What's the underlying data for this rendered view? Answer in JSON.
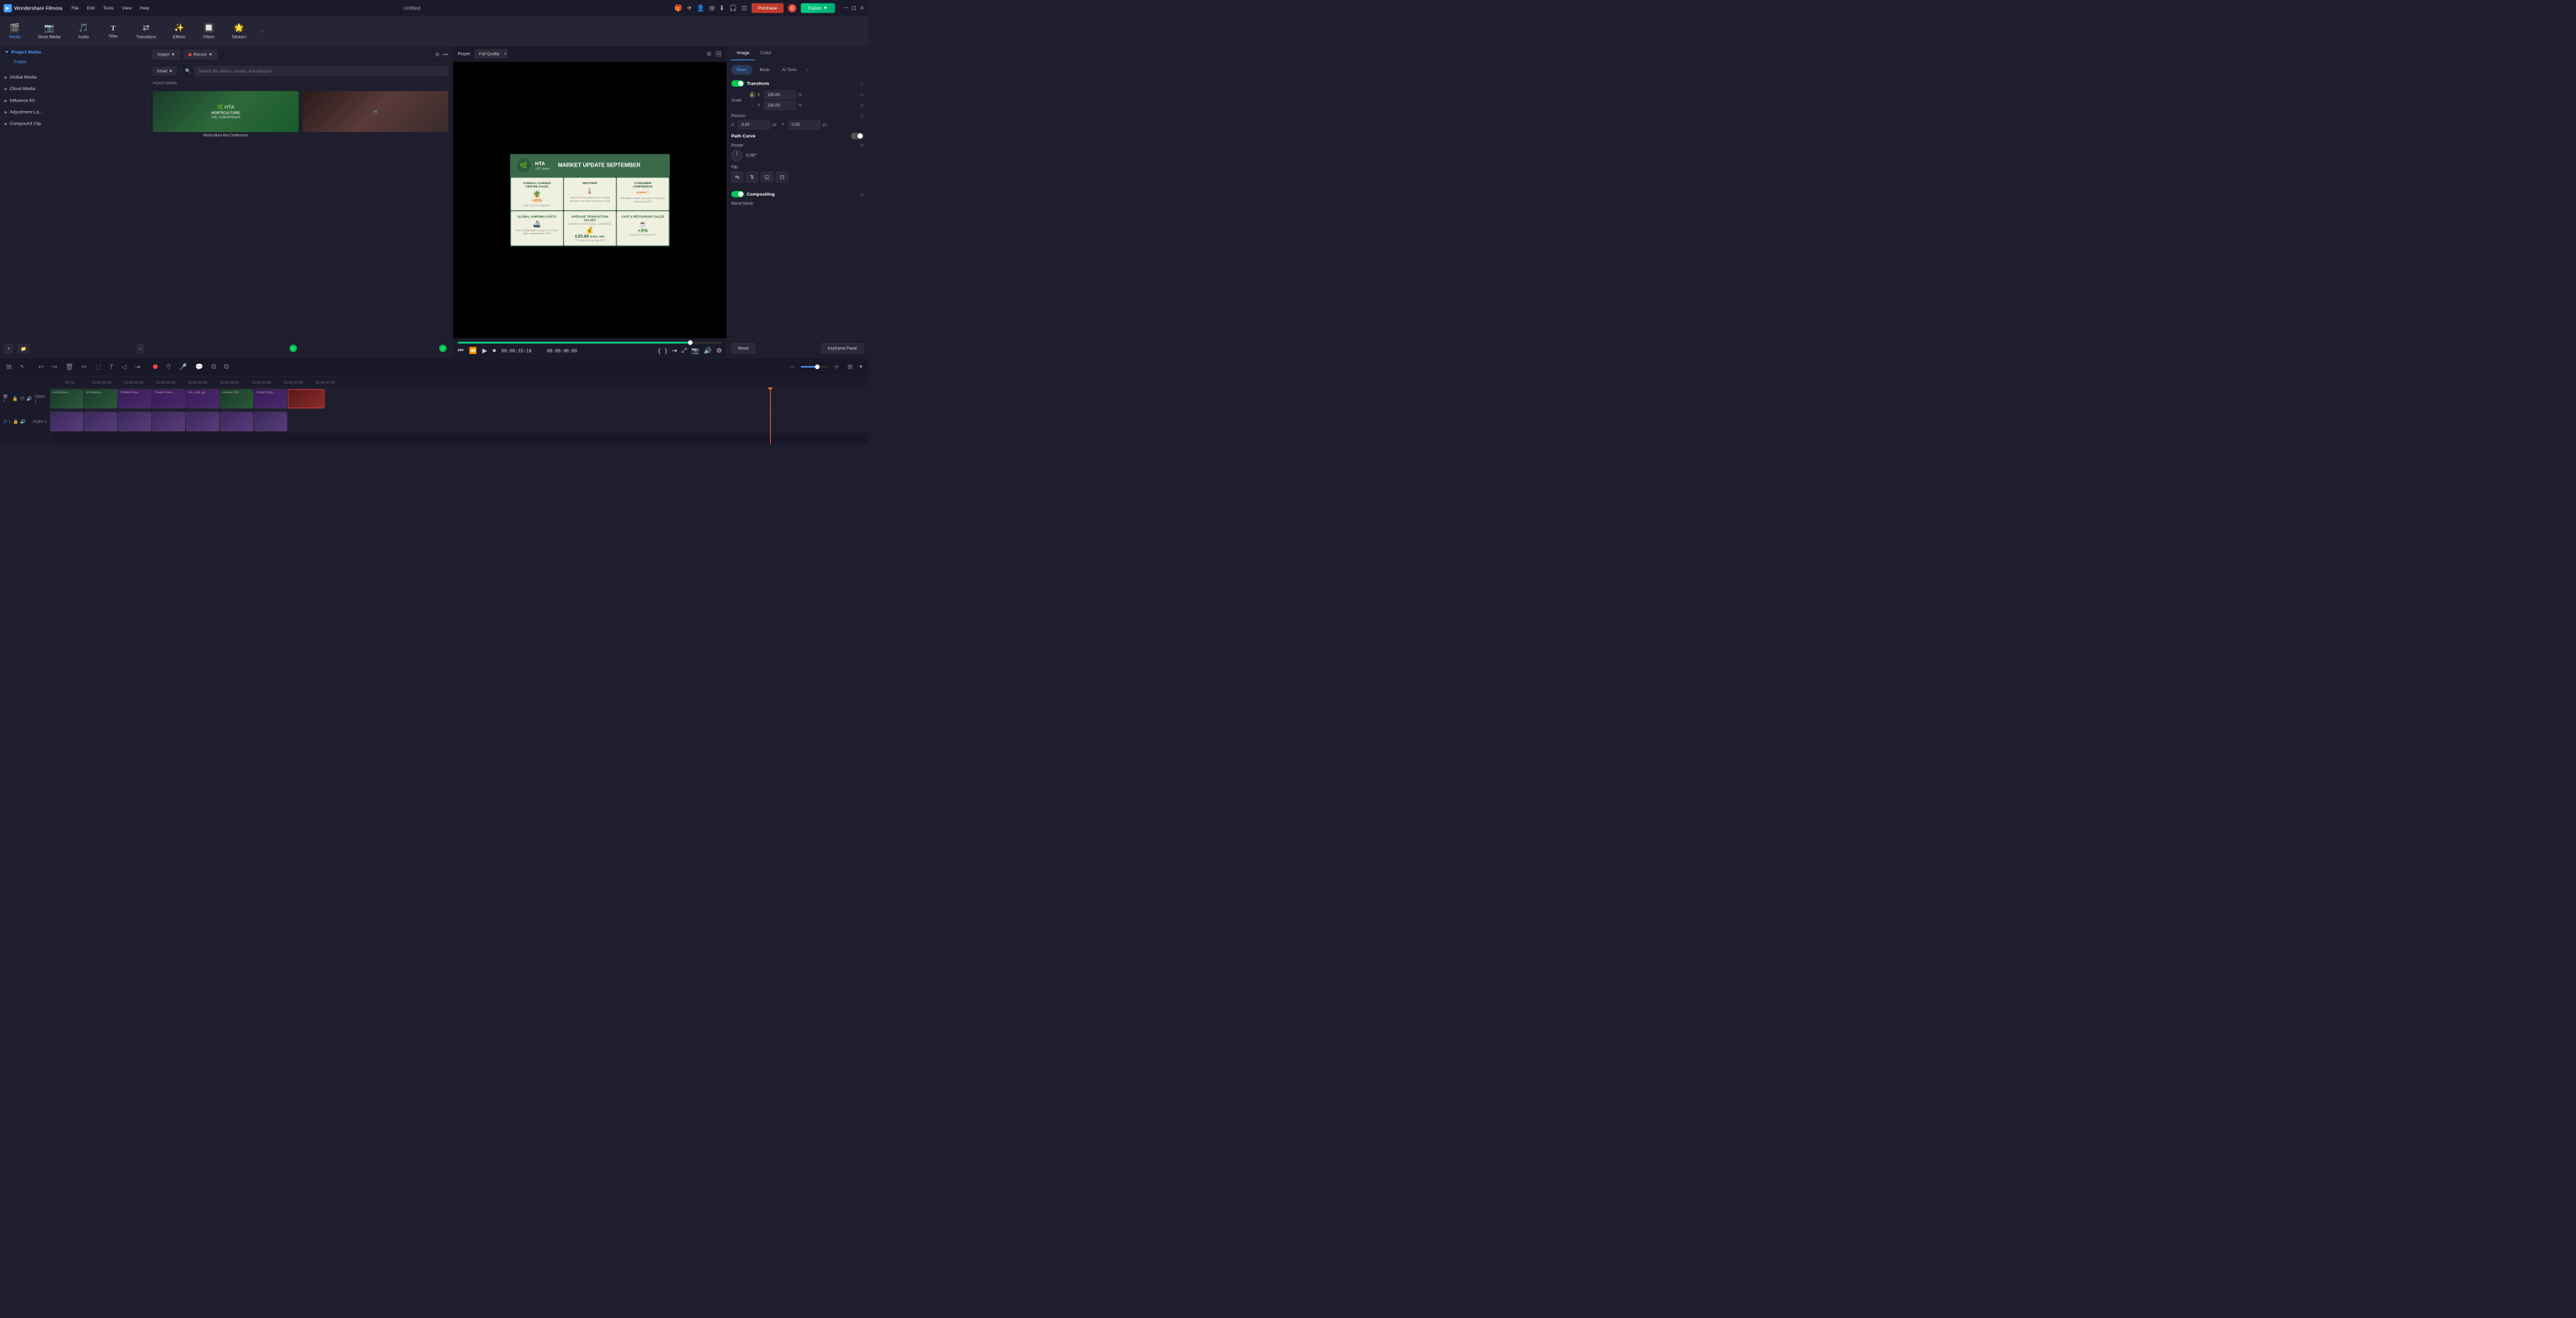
{
  "app": {
    "name": "Wondershare Filmora",
    "window_title": "Untitled"
  },
  "titlebar": {
    "menu": [
      "File",
      "Edit",
      "Tools",
      "View",
      "Help"
    ],
    "purchase_label": "Purchase",
    "export_label": "Export",
    "title": "Untitled"
  },
  "toolbar": {
    "items": [
      {
        "id": "media",
        "label": "Media",
        "icon": "🎬",
        "active": true
      },
      {
        "id": "stock_media",
        "label": "Stock Media",
        "icon": "📦"
      },
      {
        "id": "audio",
        "label": "Audio",
        "icon": "🎵"
      },
      {
        "id": "titles",
        "label": "Titles",
        "icon": "T"
      },
      {
        "id": "transitions",
        "label": "Transitions",
        "icon": "⇄"
      },
      {
        "id": "effects",
        "label": "Effects",
        "icon": "✨"
      },
      {
        "id": "filters",
        "label": "Filters",
        "icon": "🔲"
      },
      {
        "id": "stickers",
        "label": "Stickers",
        "icon": "🌟"
      }
    ]
  },
  "left_panel": {
    "project_media_label": "Project Media",
    "folder_label": "Folder",
    "sections": [
      {
        "label": "Global Media"
      },
      {
        "label": "Cloud Media"
      },
      {
        "label": "Influence Kit"
      },
      {
        "label": "Adjustment La..."
      },
      {
        "label": "Compound Clip"
      }
    ]
  },
  "media_panel": {
    "import_label": "Import",
    "record_label": "Record",
    "smart_label": "Smart",
    "search_placeholder": "Search file names, visuals, and dialogue",
    "import_media_heading": "Import Media",
    "items": [
      {
        "label": "Horticulture-the-Conference",
        "has_check": true
      },
      {
        "label": "",
        "has_check": true
      }
    ]
  },
  "player": {
    "label": "Player",
    "quality": "Full Quality",
    "current_time": "00:00:35:18",
    "total_time": "00:00:40:00",
    "progress_pct": 88
  },
  "right_panel": {
    "tabs": [
      "Image",
      "Color"
    ],
    "active_tab": "Image",
    "sub_tabs": [
      "Basic",
      "Mask",
      "AI Tools"
    ],
    "active_sub_tab": "Basic",
    "transform": {
      "label": "Transform",
      "enabled": true,
      "scale": {
        "label": "Scale",
        "x_label": "X",
        "y_label": "Y",
        "x_value": "100.00",
        "y_value": "100.00",
        "unit": "%"
      },
      "position": {
        "label": "Position",
        "x_label": "X",
        "y_label": "Y",
        "x_value": "0.00",
        "y_value": "0.00",
        "x_unit": "px",
        "y_unit": "px"
      },
      "path_curve": {
        "label": "Path Curve",
        "enabled": false
      },
      "rotate": {
        "label": "Rotate",
        "value": "0.00°"
      },
      "flip": {
        "label": "Flip",
        "buttons": [
          "⇆",
          "⇅",
          "◱",
          "◳"
        ]
      }
    },
    "compositing": {
      "label": "Compositing",
      "enabled": true
    },
    "blend_mode": {
      "label": "Blend Mode"
    },
    "reset_label": "Reset",
    "keyframe_panel_label": "Keyframe Panel"
  },
  "timeline": {
    "tracks": [
      {
        "label": "Video 1",
        "number": 1
      },
      {
        "label": "Audio 1",
        "number": 1
      }
    ],
    "clips": [
      {
        "label": "Horticulture",
        "type": "green",
        "width": 145
      },
      {
        "label": "St Martins...",
        "type": "green",
        "width": 145
      },
      {
        "label": "Theale Flow...",
        "type": "green",
        "width": 145
      },
      {
        "label": "Theale Flow...",
        "type": "green",
        "width": 145
      },
      {
        "label": "hta_and_ga...",
        "type": "green",
        "width": 145
      },
      {
        "label": "Henilan Flo...",
        "type": "green",
        "width": 145
      },
      {
        "label": "Cross Party...",
        "type": "green",
        "width": 145
      },
      {
        "label": "",
        "type": "active",
        "width": 160
      }
    ],
    "ruler_marks": [
      "00:00",
      "00:00:05:00",
      "00:00:10:00",
      "00:00:15:00",
      "00:00:20:00",
      "00:00:25:00",
      "00:00:30:00",
      "00:00:35:00",
      "00:00:40:00"
    ],
    "playhead_pct": 88
  }
}
